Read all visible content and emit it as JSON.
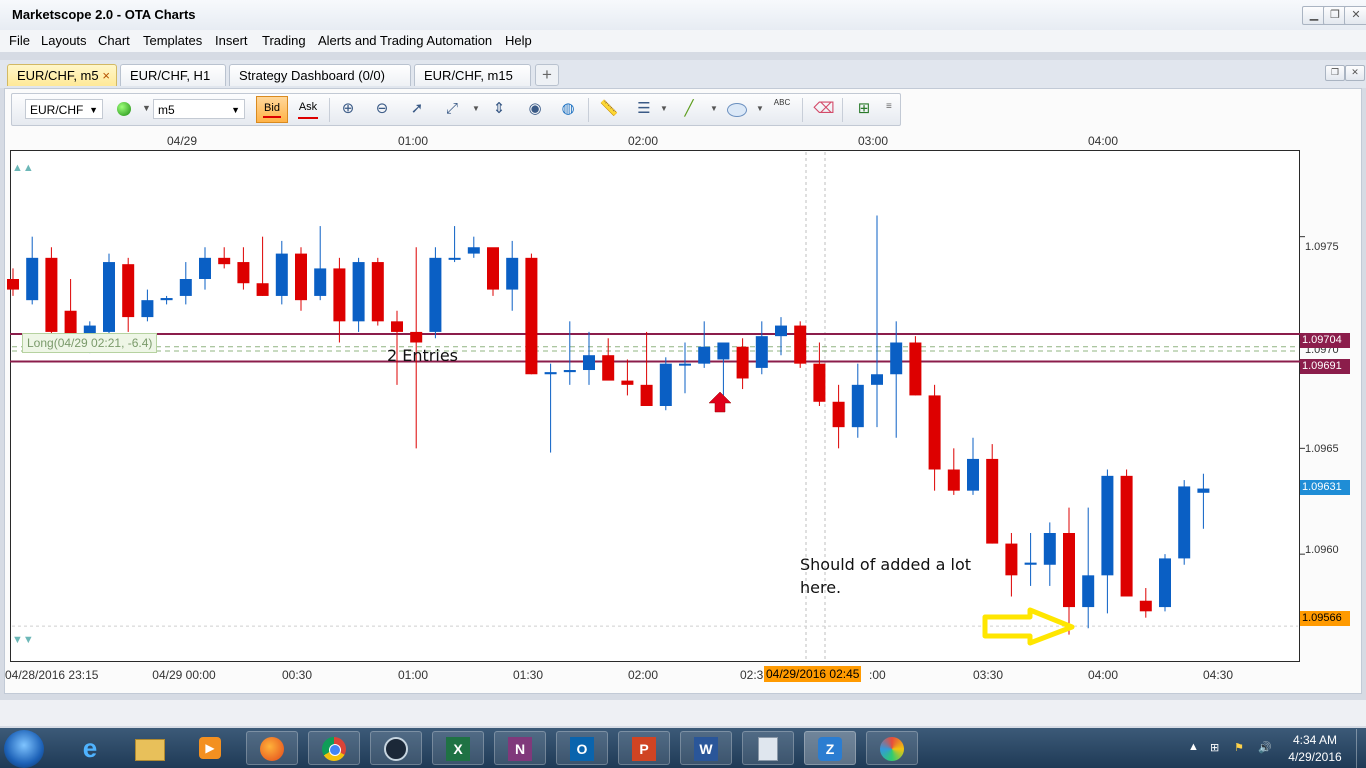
{
  "window": {
    "title": "Marketscope 2.0 - OTA Charts",
    "controls": [
      "minimize",
      "restore",
      "close"
    ]
  },
  "menu": [
    "File",
    "Layouts",
    "Chart",
    "Templates",
    "Insert",
    "Trading",
    "Alerts and Trading Automation",
    "Help"
  ],
  "tabs": [
    {
      "label": "EUR/CHF, m5",
      "active": true
    },
    {
      "label": "EUR/CHF, H1",
      "active": false
    },
    {
      "label": "Strategy Dashboard (0/0)",
      "active": false
    },
    {
      "label": "EUR/CHF, m15",
      "active": false
    }
  ],
  "tab_close": "×",
  "tab_add": "+",
  "toolbar": {
    "instrument": "EUR/CHF",
    "timeframe": "m5",
    "bid_label": "Bid",
    "ask_label": "Ask",
    "abc_label": "ABC",
    "icons": [
      "zoom-in-icon",
      "zoom-out-icon",
      "cursor-icon",
      "fit-icon",
      "vertical-range-icon",
      "eye-icon",
      "globe-icon",
      "ruler-icon",
      "lines-icon",
      "pencil-line-icon",
      "ellipse-icon",
      "text-abc-icon",
      "eraser-icon",
      "tree-icon",
      "toolbar-menu-icon"
    ]
  },
  "chart": {
    "top_time_labels": [
      "04/29",
      "01:00",
      "02:00",
      "03:00",
      "04:00"
    ],
    "bottom_time_labels": [
      "04/28/2016 23:15",
      "04/29 00:00",
      "00:30",
      "01:00",
      "01:30",
      "02:00",
      "02:3",
      ":00",
      "03:30",
      "04:00",
      "04:30"
    ],
    "cursor_time": "04/29/2016 02:45",
    "y_tick_labels": [
      "1.0975",
      "1.0970",
      "1.0965",
      "1.0960"
    ],
    "price_tags": {
      "line_upper": "1.09704",
      "line_lower": "1.09691",
      "current": "1.09631",
      "cursor_price": "1.09566"
    },
    "position_label": "Long(04/29 02:21, -6.4)",
    "annotations": {
      "entries": "2 Entries",
      "note_line1": "Should of added a lot",
      "note_line2": "here."
    },
    "colors": {
      "up": "#0a5fc4",
      "down": "#dd0000",
      "orders": "#8b1d4b",
      "position": "#6c9c58",
      "current_tag": "#1f8dd6",
      "cursor_tag": "#ff9a00",
      "annotation_arrow": "#ffe600"
    }
  },
  "chart_data": {
    "type": "candlestick",
    "ylim": [
      1.0955,
      1.0979
    ],
    "x_time_labels": [
      "04/28/2016 23:15",
      "04/29 00:00",
      "00:30",
      "01:00",
      "01:30",
      "02:00",
      "03:30",
      "04:00",
      "04:30"
    ],
    "candles": [
      {
        "o": 1.0973,
        "h": 1.09735,
        "l": 1.09722,
        "c": 1.09725
      },
      {
        "o": 1.0972,
        "h": 1.0975,
        "l": 1.09718,
        "c": 1.0974
      },
      {
        "o": 1.0974,
        "h": 1.09745,
        "l": 1.09696,
        "c": 1.09705
      },
      {
        "o": 1.09715,
        "h": 1.0973,
        "l": 1.09698,
        "c": 1.09698
      },
      {
        "o": 1.09698,
        "h": 1.0971,
        "l": 1.09695,
        "c": 1.09708
      },
      {
        "o": 1.09705,
        "h": 1.09742,
        "l": 1.097,
        "c": 1.09738
      },
      {
        "o": 1.09737,
        "h": 1.0974,
        "l": 1.09705,
        "c": 1.09712
      },
      {
        "o": 1.09712,
        "h": 1.09725,
        "l": 1.0971,
        "c": 1.0972
      },
      {
        "o": 1.0972,
        "h": 1.09722,
        "l": 1.09718,
        "c": 1.09721
      },
      {
        "o": 1.09722,
        "h": 1.09738,
        "l": 1.09718,
        "c": 1.0973
      },
      {
        "o": 1.0973,
        "h": 1.09745,
        "l": 1.09725,
        "c": 1.0974
      },
      {
        "o": 1.0974,
        "h": 1.09745,
        "l": 1.09735,
        "c": 1.09737
      },
      {
        "o": 1.09738,
        "h": 1.09745,
        "l": 1.09725,
        "c": 1.09728
      },
      {
        "o": 1.09728,
        "h": 1.0975,
        "l": 1.09722,
        "c": 1.09722
      },
      {
        "o": 1.09722,
        "h": 1.09748,
        "l": 1.09718,
        "c": 1.09742
      },
      {
        "o": 1.09742,
        "h": 1.09745,
        "l": 1.09715,
        "c": 1.0972
      },
      {
        "o": 1.09722,
        "h": 1.09755,
        "l": 1.0972,
        "c": 1.09735
      },
      {
        "o": 1.09735,
        "h": 1.0974,
        "l": 1.097,
        "c": 1.0971
      },
      {
        "o": 1.0971,
        "h": 1.0974,
        "l": 1.09705,
        "c": 1.09738
      },
      {
        "o": 1.09738,
        "h": 1.0974,
        "l": 1.09708,
        "c": 1.0971
      },
      {
        "o": 1.0971,
        "h": 1.09715,
        "l": 1.0968,
        "c": 1.09705
      },
      {
        "o": 1.09705,
        "h": 1.09745,
        "l": 1.0965,
        "c": 1.097
      },
      {
        "o": 1.09705,
        "h": 1.09745,
        "l": 1.09702,
        "c": 1.0974
      },
      {
        "o": 1.0974,
        "h": 1.09755,
        "l": 1.09738,
        "c": 1.0974
      },
      {
        "o": 1.09742,
        "h": 1.0975,
        "l": 1.0974,
        "c": 1.09745
      },
      {
        "o": 1.09745,
        "h": 1.09742,
        "l": 1.09722,
        "c": 1.09725
      },
      {
        "o": 1.09725,
        "h": 1.09748,
        "l": 1.09715,
        "c": 1.0974
      },
      {
        "o": 1.0974,
        "h": 1.09742,
        "l": 1.09685,
        "c": 1.09685
      },
      {
        "o": 1.09685,
        "h": 1.0969,
        "l": 1.09648,
        "c": 1.09686
      },
      {
        "o": 1.09686,
        "h": 1.0971,
        "l": 1.0968,
        "c": 1.09687
      },
      {
        "o": 1.09687,
        "h": 1.09705,
        "l": 1.0968,
        "c": 1.09694
      },
      {
        "o": 1.09694,
        "h": 1.09702,
        "l": 1.09688,
        "c": 1.09682
      },
      {
        "o": 1.09682,
        "h": 1.09692,
        "l": 1.09675,
        "c": 1.0968
      },
      {
        "o": 1.0968,
        "h": 1.09705,
        "l": 1.0967,
        "c": 1.0967
      },
      {
        "o": 1.0967,
        "h": 1.09693,
        "l": 1.09668,
        "c": 1.0969
      },
      {
        "o": 1.0969,
        "h": 1.097,
        "l": 1.09676,
        "c": 1.0969
      },
      {
        "o": 1.0969,
        "h": 1.0971,
        "l": 1.09688,
        "c": 1.09698
      },
      {
        "o": 1.09692,
        "h": 1.097,
        "l": 1.09675,
        "c": 1.097
      },
      {
        "o": 1.09698,
        "h": 1.09702,
        "l": 1.09678,
        "c": 1.09683
      },
      {
        "o": 1.09688,
        "h": 1.0971,
        "l": 1.09685,
        "c": 1.09703
      },
      {
        "o": 1.09703,
        "h": 1.09712,
        "l": 1.09694,
        "c": 1.09708
      },
      {
        "o": 1.09708,
        "h": 1.0971,
        "l": 1.09688,
        "c": 1.0969
      },
      {
        "o": 1.0969,
        "h": 1.097,
        "l": 1.0967,
        "c": 1.09672
      },
      {
        "o": 1.09672,
        "h": 1.0968,
        "l": 1.0965,
        "c": 1.0966
      },
      {
        "o": 1.0966,
        "h": 1.0969,
        "l": 1.09655,
        "c": 1.0968
      },
      {
        "o": 1.0968,
        "h": 1.0976,
        "l": 1.0966,
        "c": 1.09685
      },
      {
        "o": 1.09685,
        "h": 1.0971,
        "l": 1.09655,
        "c": 1.097
      },
      {
        "o": 1.097,
        "h": 1.09703,
        "l": 1.09675,
        "c": 1.09675
      },
      {
        "o": 1.09675,
        "h": 1.0968,
        "l": 1.0963,
        "c": 1.0964
      },
      {
        "o": 1.0964,
        "h": 1.0965,
        "l": 1.09628,
        "c": 1.0963
      },
      {
        "o": 1.0963,
        "h": 1.09655,
        "l": 1.09628,
        "c": 1.09645
      },
      {
        "o": 1.09645,
        "h": 1.09652,
        "l": 1.09605,
        "c": 1.09605
      },
      {
        "o": 1.09605,
        "h": 1.0961,
        "l": 1.0958,
        "c": 1.0959
      },
      {
        "o": 1.09595,
        "h": 1.0961,
        "l": 1.09585,
        "c": 1.09596
      },
      {
        "o": 1.09595,
        "h": 1.09615,
        "l": 1.09585,
        "c": 1.0961
      },
      {
        "o": 1.0961,
        "h": 1.09622,
        "l": 1.09562,
        "c": 1.09575
      },
      {
        "o": 1.09575,
        "h": 1.09622,
        "l": 1.09565,
        "c": 1.0959
      },
      {
        "o": 1.0959,
        "h": 1.0964,
        "l": 1.09572,
        "c": 1.09637
      },
      {
        "o": 1.09637,
        "h": 1.0964,
        "l": 1.0958,
        "c": 1.0958
      },
      {
        "o": 1.09578,
        "h": 1.09584,
        "l": 1.0957,
        "c": 1.09573
      },
      {
        "o": 1.09575,
        "h": 1.096,
        "l": 1.09573,
        "c": 1.09598
      },
      {
        "o": 1.09598,
        "h": 1.09635,
        "l": 1.09595,
        "c": 1.09632
      },
      {
        "o": 1.09629,
        "h": 1.09638,
        "l": 1.09612,
        "c": 1.09631
      }
    ],
    "horizontal_lines": [
      1.09704,
      1.09691
    ],
    "current_price": 1.09631
  },
  "taskbar": {
    "apps": [
      "internet-explorer-icon",
      "file-explorer-icon",
      "media-player-icon",
      "firefox-icon",
      "chrome-icon",
      "steam-icon",
      "excel-icon",
      "onenote-icon",
      "outlook-icon",
      "powerpoint-icon",
      "word-icon",
      "calculator-icon",
      "fxcm-icon",
      "paint-icon"
    ],
    "excel_letter": "X",
    "onenote_letter": "N",
    "outlook_letter": "O",
    "powerpoint_letter": "P",
    "word_letter": "W",
    "time": "4:34 AM",
    "date": "4/29/2016"
  }
}
